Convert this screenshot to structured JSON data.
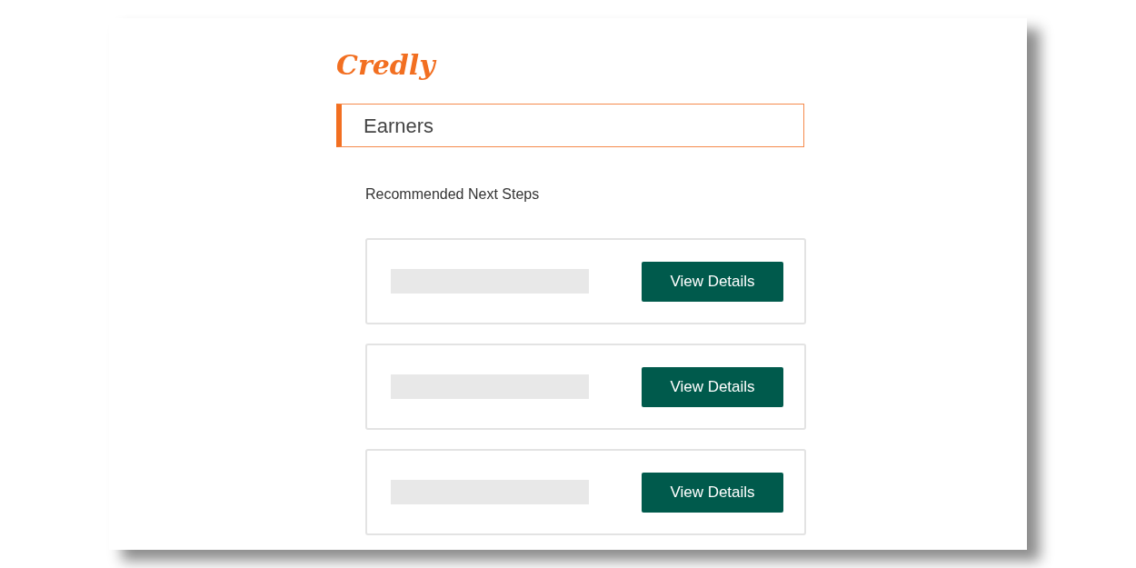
{
  "logo": "Credly",
  "heading": "Earners",
  "section_title": "Recommended Next Steps",
  "steps": [
    {
      "loading": true,
      "button": "View Details"
    },
    {
      "loading": true,
      "button": "View Details"
    },
    {
      "loading": true,
      "button": "View Details"
    }
  ]
}
